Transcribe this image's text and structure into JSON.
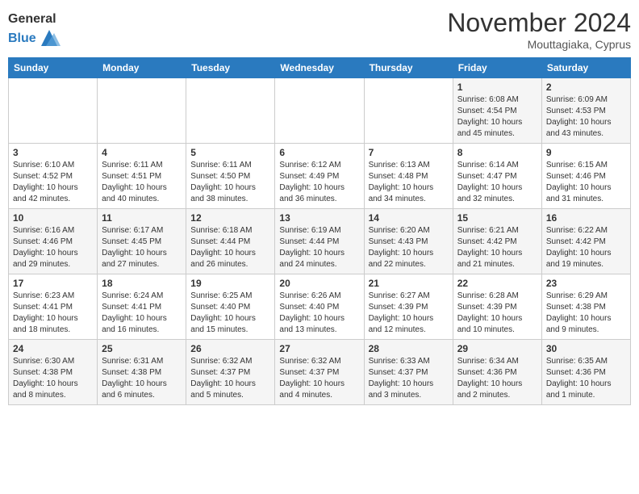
{
  "header": {
    "logo_line1": "General",
    "logo_line2": "Blue",
    "month": "November 2024",
    "location": "Mouttagiaka, Cyprus"
  },
  "weekdays": [
    "Sunday",
    "Monday",
    "Tuesday",
    "Wednesday",
    "Thursday",
    "Friday",
    "Saturday"
  ],
  "weeks": [
    [
      {
        "day": "",
        "info": ""
      },
      {
        "day": "",
        "info": ""
      },
      {
        "day": "",
        "info": ""
      },
      {
        "day": "",
        "info": ""
      },
      {
        "day": "",
        "info": ""
      },
      {
        "day": "1",
        "info": "Sunrise: 6:08 AM\nSunset: 4:54 PM\nDaylight: 10 hours\nand 45 minutes."
      },
      {
        "day": "2",
        "info": "Sunrise: 6:09 AM\nSunset: 4:53 PM\nDaylight: 10 hours\nand 43 minutes."
      }
    ],
    [
      {
        "day": "3",
        "info": "Sunrise: 6:10 AM\nSunset: 4:52 PM\nDaylight: 10 hours\nand 42 minutes."
      },
      {
        "day": "4",
        "info": "Sunrise: 6:11 AM\nSunset: 4:51 PM\nDaylight: 10 hours\nand 40 minutes."
      },
      {
        "day": "5",
        "info": "Sunrise: 6:11 AM\nSunset: 4:50 PM\nDaylight: 10 hours\nand 38 minutes."
      },
      {
        "day": "6",
        "info": "Sunrise: 6:12 AM\nSunset: 4:49 PM\nDaylight: 10 hours\nand 36 minutes."
      },
      {
        "day": "7",
        "info": "Sunrise: 6:13 AM\nSunset: 4:48 PM\nDaylight: 10 hours\nand 34 minutes."
      },
      {
        "day": "8",
        "info": "Sunrise: 6:14 AM\nSunset: 4:47 PM\nDaylight: 10 hours\nand 32 minutes."
      },
      {
        "day": "9",
        "info": "Sunrise: 6:15 AM\nSunset: 4:46 PM\nDaylight: 10 hours\nand 31 minutes."
      }
    ],
    [
      {
        "day": "10",
        "info": "Sunrise: 6:16 AM\nSunset: 4:46 PM\nDaylight: 10 hours\nand 29 minutes."
      },
      {
        "day": "11",
        "info": "Sunrise: 6:17 AM\nSunset: 4:45 PM\nDaylight: 10 hours\nand 27 minutes."
      },
      {
        "day": "12",
        "info": "Sunrise: 6:18 AM\nSunset: 4:44 PM\nDaylight: 10 hours\nand 26 minutes."
      },
      {
        "day": "13",
        "info": "Sunrise: 6:19 AM\nSunset: 4:44 PM\nDaylight: 10 hours\nand 24 minutes."
      },
      {
        "day": "14",
        "info": "Sunrise: 6:20 AM\nSunset: 4:43 PM\nDaylight: 10 hours\nand 22 minutes."
      },
      {
        "day": "15",
        "info": "Sunrise: 6:21 AM\nSunset: 4:42 PM\nDaylight: 10 hours\nand 21 minutes."
      },
      {
        "day": "16",
        "info": "Sunrise: 6:22 AM\nSunset: 4:42 PM\nDaylight: 10 hours\nand 19 minutes."
      }
    ],
    [
      {
        "day": "17",
        "info": "Sunrise: 6:23 AM\nSunset: 4:41 PM\nDaylight: 10 hours\nand 18 minutes."
      },
      {
        "day": "18",
        "info": "Sunrise: 6:24 AM\nSunset: 4:41 PM\nDaylight: 10 hours\nand 16 minutes."
      },
      {
        "day": "19",
        "info": "Sunrise: 6:25 AM\nSunset: 4:40 PM\nDaylight: 10 hours\nand 15 minutes."
      },
      {
        "day": "20",
        "info": "Sunrise: 6:26 AM\nSunset: 4:40 PM\nDaylight: 10 hours\nand 13 minutes."
      },
      {
        "day": "21",
        "info": "Sunrise: 6:27 AM\nSunset: 4:39 PM\nDaylight: 10 hours\nand 12 minutes."
      },
      {
        "day": "22",
        "info": "Sunrise: 6:28 AM\nSunset: 4:39 PM\nDaylight: 10 hours\nand 10 minutes."
      },
      {
        "day": "23",
        "info": "Sunrise: 6:29 AM\nSunset: 4:38 PM\nDaylight: 10 hours\nand 9 minutes."
      }
    ],
    [
      {
        "day": "24",
        "info": "Sunrise: 6:30 AM\nSunset: 4:38 PM\nDaylight: 10 hours\nand 8 minutes."
      },
      {
        "day": "25",
        "info": "Sunrise: 6:31 AM\nSunset: 4:38 PM\nDaylight: 10 hours\nand 6 minutes."
      },
      {
        "day": "26",
        "info": "Sunrise: 6:32 AM\nSunset: 4:37 PM\nDaylight: 10 hours\nand 5 minutes."
      },
      {
        "day": "27",
        "info": "Sunrise: 6:32 AM\nSunset: 4:37 PM\nDaylight: 10 hours\nand 4 minutes."
      },
      {
        "day": "28",
        "info": "Sunrise: 6:33 AM\nSunset: 4:37 PM\nDaylight: 10 hours\nand 3 minutes."
      },
      {
        "day": "29",
        "info": "Sunrise: 6:34 AM\nSunset: 4:36 PM\nDaylight: 10 hours\nand 2 minutes."
      },
      {
        "day": "30",
        "info": "Sunrise: 6:35 AM\nSunset: 4:36 PM\nDaylight: 10 hours\nand 1 minute."
      }
    ]
  ]
}
